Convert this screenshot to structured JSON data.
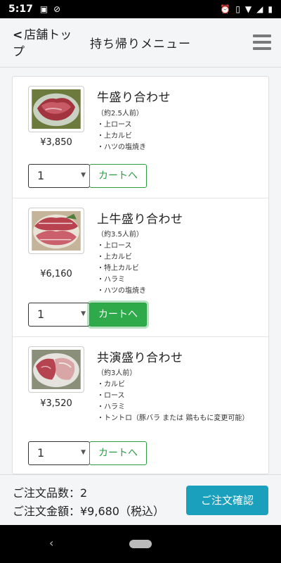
{
  "status": {
    "time": "5:17"
  },
  "header": {
    "back_label": "店舗トップ",
    "title": "持ち帰りメニュー"
  },
  "items": [
    {
      "name": "牛盛り合わせ",
      "price": "¥3,850",
      "servings": "（約2.5人前）",
      "contents": [
        "・上ロース",
        "・上カルビ",
        "・ハツの塩焼き"
      ],
      "quantity": "1",
      "cart_label": "カートへ"
    },
    {
      "name": "上牛盛り合わせ",
      "price": "¥6,160",
      "servings": "（約3.5人前）",
      "contents": [
        "・上ロース",
        "・上カルビ",
        "・特上カルビ",
        "・ハラミ",
        "・ハツの塩焼き"
      ],
      "quantity": "1",
      "cart_label": "カートへ"
    },
    {
      "name": "共演盛り合わせ",
      "price": "¥3,520",
      "servings": "（約3人前）",
      "contents": [
        "・カルビ",
        "・ロース",
        "・ハラミ",
        "・トントロ（豚バラ または 鶏ももに変更可能）"
      ],
      "quantity": "1",
      "cart_label": "カートへ"
    }
  ],
  "footer": {
    "count_label": "ご注文品数：2",
    "total_label": "ご注文金額：¥9,680（税込）",
    "confirm_label": "ご注文確認"
  },
  "colors": {
    "accent_green": "#2e9e45",
    "confirm_blue": "#1a9fbd"
  }
}
